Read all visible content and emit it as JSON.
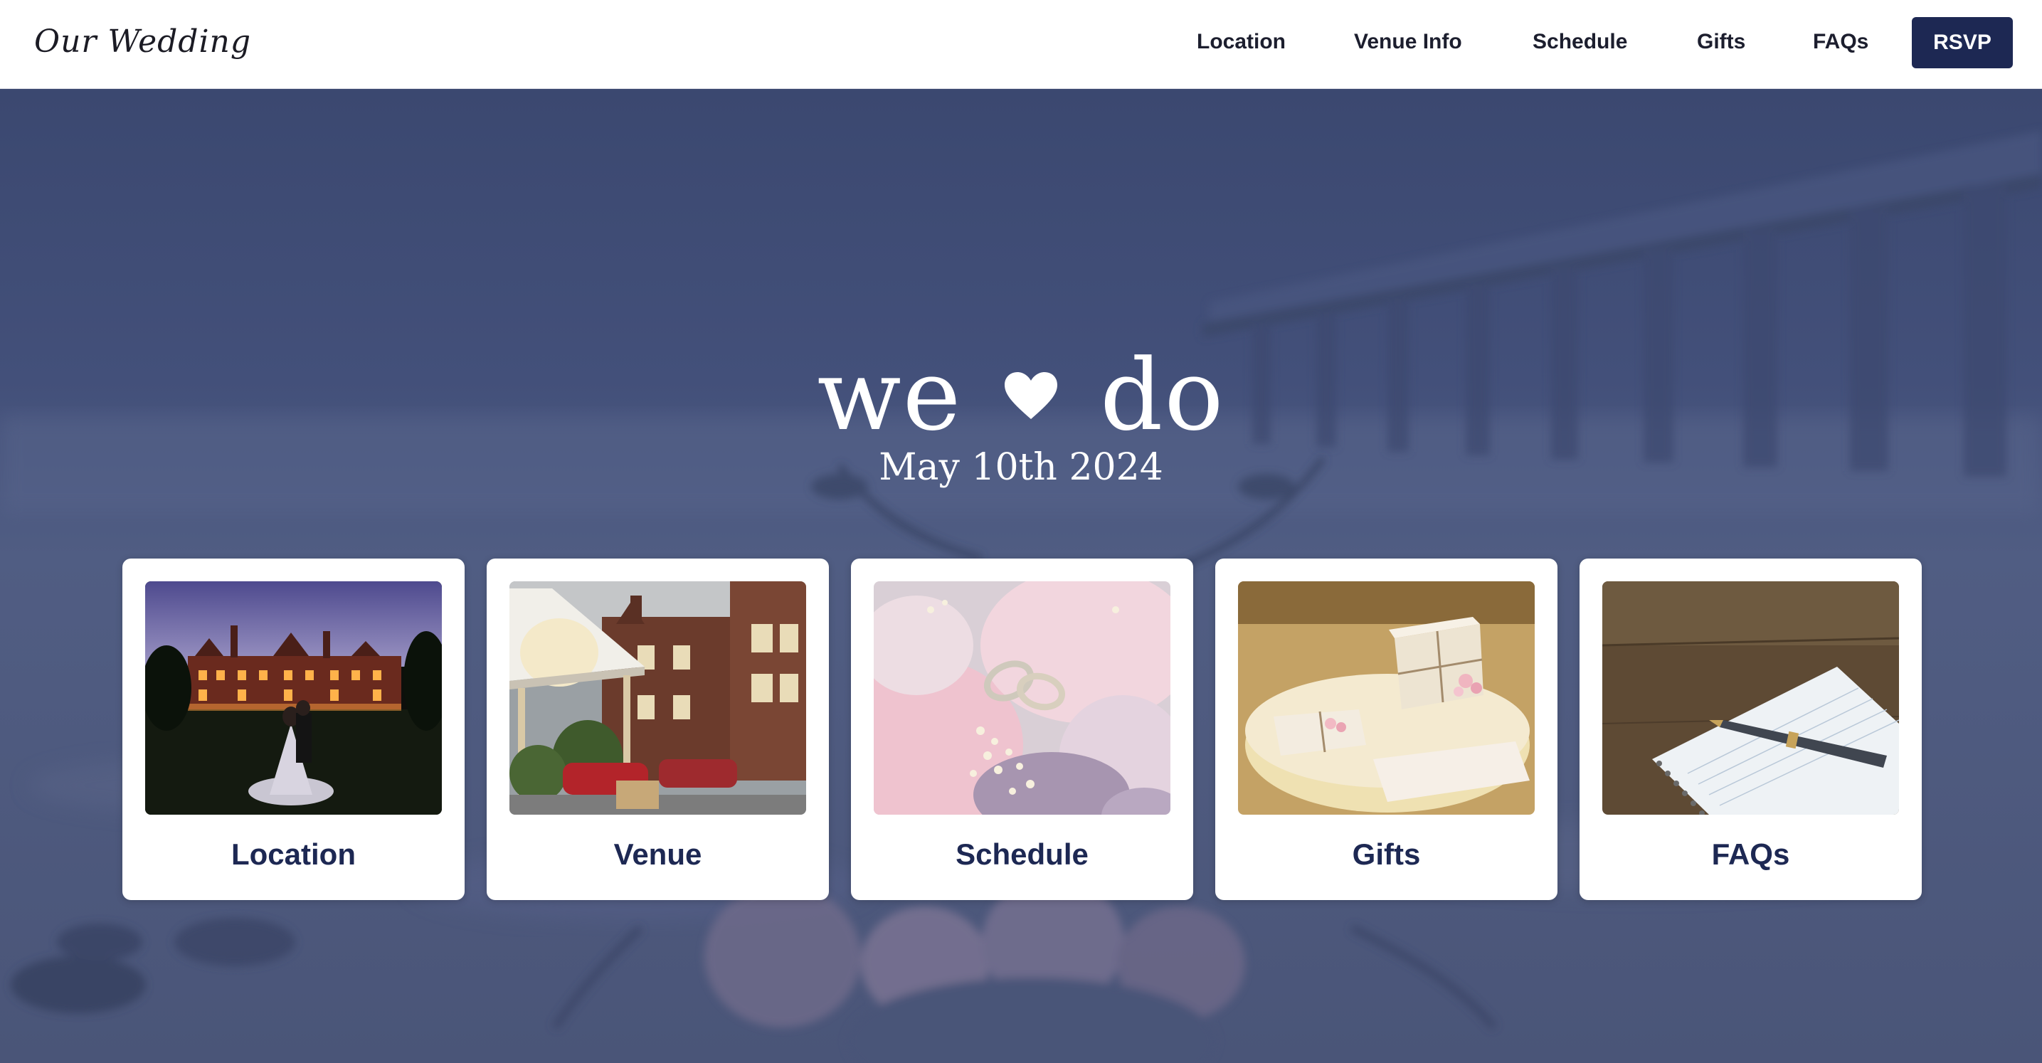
{
  "header": {
    "logo": "Our Wedding",
    "nav": [
      "Location",
      "Venue Info",
      "Schedule",
      "Gifts",
      "FAQs"
    ],
    "rsvp_label": "RSVP"
  },
  "hero": {
    "title_left": "we",
    "title_right": "do",
    "heart_icon": "heart-icon",
    "date": "May 10th 2024"
  },
  "cards": [
    {
      "label": "Location",
      "image": "manor-house-at-night-with-couple"
    },
    {
      "label": "Venue",
      "image": "hotel-entrance-brick-building"
    },
    {
      "label": "Schedule",
      "image": "wedding-rings-on-flowers"
    },
    {
      "label": "Gifts",
      "image": "wrapped-gift-boxes"
    },
    {
      "label": "FAQs",
      "image": "notebook-and-fountain-pen"
    }
  ],
  "colors": {
    "navy": "#1d2853",
    "overlay": "#3d4a6e",
    "card_bg": "#ffffff"
  }
}
